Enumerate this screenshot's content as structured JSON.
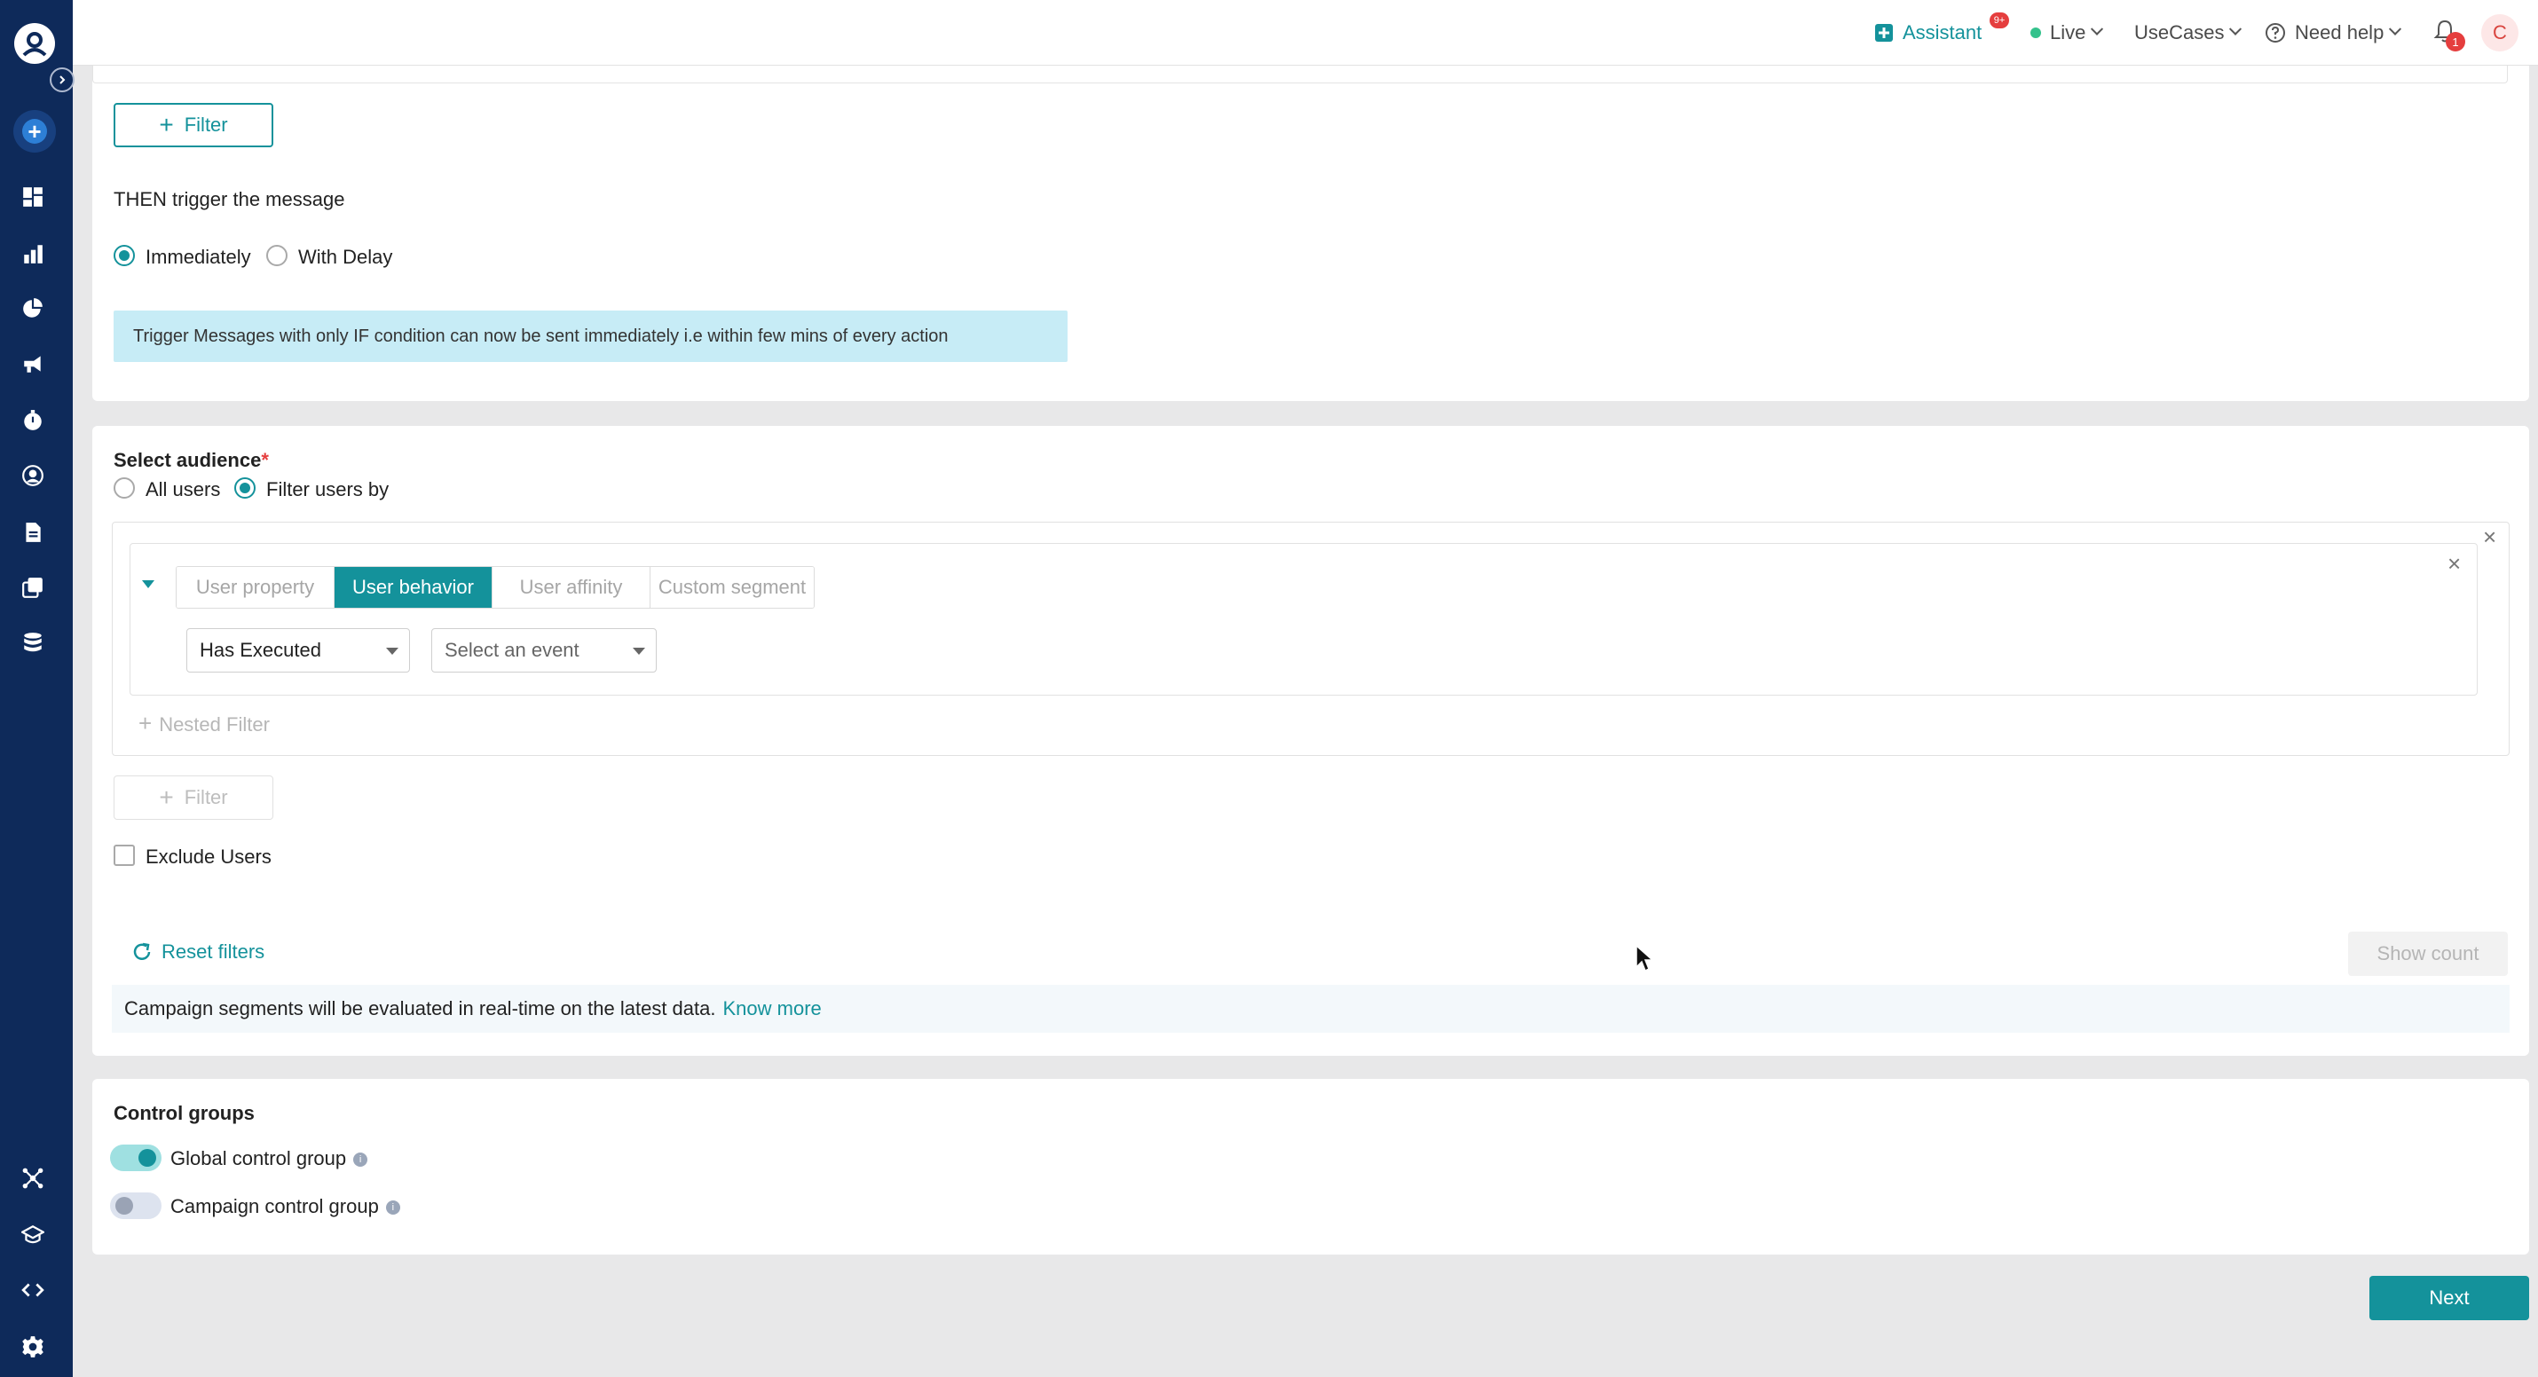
{
  "topbar": {
    "assistant_label": "Assistant",
    "assistant_badge": "9+",
    "live_label": "Live",
    "usecases_label": "UseCases",
    "help_label": "Need help",
    "notification_count": "1",
    "avatar_initial": "C"
  },
  "trigger": {
    "filter_button_label": "Filter",
    "heading": "THEN trigger the message",
    "option_immediately": "Immediately",
    "option_with_delay": "With Delay",
    "info_text": "Trigger Messages with only IF condition can now be sent immediately i.e within few mins of every action"
  },
  "audience": {
    "heading": "Select audience",
    "required_mark": "*",
    "option_all_users": "All users",
    "option_filter_users": "Filter users by",
    "tabs": [
      "User property",
      "User behavior",
      "User affinity",
      "Custom segment"
    ],
    "active_tab": "User behavior",
    "condition_select": "Has Executed",
    "event_placeholder": "Select an event",
    "nested_filter_label": "Nested Filter",
    "filter_button_label": "Filter",
    "exclude_users_label": "Exclude Users",
    "reset_filters_label": "Reset filters",
    "show_count_label": "Show count",
    "note_text": "Campaign segments will be evaluated in real-time on the latest data.",
    "know_more_label": "Know more"
  },
  "control_groups": {
    "heading": "Control groups",
    "global_label": "Global control group",
    "global_enabled": true,
    "campaign_label": "Campaign control group",
    "campaign_enabled": false
  },
  "footer": {
    "next_label": "Next"
  },
  "colors": {
    "accent": "#14929b",
    "sidebar_bg": "#0e2a5a",
    "info_bg": "#c7ecf6"
  },
  "sidebar_icons": [
    "logo-icon",
    "expand-icon",
    "add-icon",
    "dashboard-icon",
    "analytics-icon",
    "segments-pie-icon",
    "campaigns-megaphone-icon",
    "timer-icon",
    "user-profile-icon",
    "document-icon",
    "content-library-icon",
    "database-icon",
    "integrations-icon",
    "academy-icon",
    "code-icon",
    "settings-icon"
  ]
}
